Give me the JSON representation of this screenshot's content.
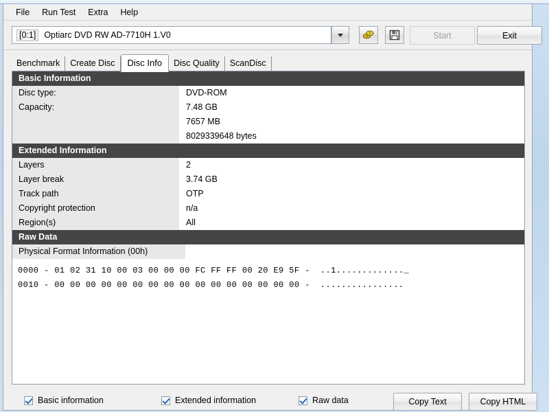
{
  "menu": {
    "items": [
      {
        "label": "File"
      },
      {
        "label": "Run Test"
      },
      {
        "label": "Extra"
      },
      {
        "label": "Help"
      }
    ]
  },
  "toolbar": {
    "drive_id": "[0:1]",
    "drive_name": "Optiarc DVD RW AD-7710H 1.V0",
    "dropdown_icon": "chevron-down-icon",
    "eject_icon": "eject-disc-icon",
    "save_icon": "floppy-save-icon",
    "start_label": "Start",
    "exit_label": "Exit"
  },
  "tabs": [
    {
      "label": "Benchmark",
      "active": false
    },
    {
      "label": "Create Disc",
      "active": false
    },
    {
      "label": "Disc Info",
      "active": true
    },
    {
      "label": "Disc Quality",
      "active": false
    },
    {
      "label": "ScanDisc",
      "active": false
    }
  ],
  "sections": {
    "basic": {
      "title": "Basic Information",
      "rows": [
        {
          "label": "Disc type:",
          "value": "DVD-ROM"
        },
        {
          "label": "Capacity:",
          "value": "7.48 GB"
        },
        {
          "label": "",
          "value": "7657 MB"
        },
        {
          "label": "",
          "value": "8029339648 bytes"
        }
      ]
    },
    "extended": {
      "title": "Extended Information",
      "rows": [
        {
          "label": "Layers",
          "value": "2"
        },
        {
          "label": "Layer break",
          "value": "3.74 GB"
        },
        {
          "label": "Track path",
          "value": "OTP"
        },
        {
          "label": "Copyright protection",
          "value": "n/a"
        },
        {
          "label": "Region(s)",
          "value": "All"
        }
      ]
    },
    "raw": {
      "title": "Raw Data",
      "subheader": "Physical Format Information (00h)",
      "dump": "0000 - 01 02 31 10 00 03 00 00 00 FC FF FF 00 20 E9 5F -  ..1............._\n0010 - 00 00 00 00 00 00 00 00 00 00 00 00 00 00 00 00 -  ................"
    }
  },
  "footer": {
    "checkboxes": [
      {
        "label": "Basic information",
        "checked": true
      },
      {
        "label": "Extended information",
        "checked": true
      },
      {
        "label": "Raw data",
        "checked": true
      }
    ],
    "copy_text_label": "Copy Text",
    "copy_html_label": "Copy HTML"
  }
}
